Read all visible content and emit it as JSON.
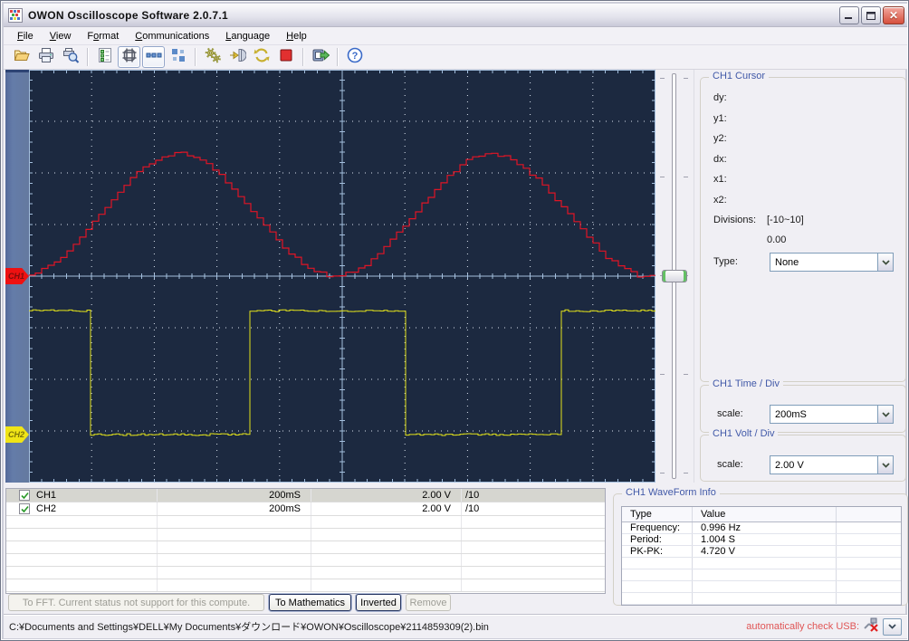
{
  "window": {
    "title": "OWON Oscilloscope Software 2.0.7.1"
  },
  "colors": {
    "scope_bg": "#1c2940",
    "grid_line": "#a3bedd",
    "grid_dot": "#dbe4f0",
    "left_strip": "#5f78a8",
    "group_title": "#4159a8",
    "usb_text": "#e05555"
  },
  "menu_bar": {
    "items": [
      {
        "label": "File",
        "underline": 0
      },
      {
        "label": "View",
        "underline": 0
      },
      {
        "label": "Format",
        "underline": 1
      },
      {
        "label": "Communications",
        "underline": 0
      },
      {
        "label": "Language",
        "underline": 0
      },
      {
        "label": "Help",
        "underline": 0
      }
    ]
  },
  "toolbar": {
    "items": [
      {
        "type": "button",
        "name": "open-file-button",
        "icon": "folder-open-icon"
      },
      {
        "type": "button",
        "name": "print-button",
        "icon": "printer-icon"
      },
      {
        "type": "button",
        "name": "print-preview-button",
        "icon": "print-preview-icon"
      },
      {
        "type": "separator"
      },
      {
        "type": "button",
        "name": "channel-list-button",
        "icon": "list-icon"
      },
      {
        "type": "button",
        "name": "grid-display-button",
        "icon": "grid-icon",
        "pressed": true
      },
      {
        "type": "button",
        "name": "dot-line-display-button",
        "icon": "dot-line-icon",
        "pressed": true
      },
      {
        "type": "button",
        "name": "tile-windows-button",
        "icon": "tile-icon"
      },
      {
        "type": "separator"
      },
      {
        "type": "button",
        "name": "settings-button",
        "icon": "gears-icon"
      },
      {
        "type": "button",
        "name": "connect-device-button",
        "icon": "connect-icon"
      },
      {
        "type": "button",
        "name": "refresh-button",
        "icon": "refresh-icon"
      },
      {
        "type": "button",
        "name": "stop-button",
        "icon": "stop-icon"
      },
      {
        "type": "separator"
      },
      {
        "type": "button",
        "name": "record-button",
        "icon": "record-icon"
      },
      {
        "type": "separator"
      },
      {
        "type": "button",
        "name": "help-button",
        "icon": "help-icon"
      }
    ]
  },
  "scope": {
    "channel_tags": [
      {
        "label": "CH1",
        "bg": "#ee1111",
        "text_color": "#7d0c0c",
        "zero_level_div": 0
      },
      {
        "label": "CH2",
        "bg": "#f0e416",
        "text_color": "#7c7308",
        "zero_level_div": -3.07
      }
    ]
  },
  "chart_data": {
    "type": "line",
    "title": "Oscilloscope waveform display",
    "x_divisions": 10,
    "y_divisions": 8,
    "time_per_div": "200mS",
    "series": [
      {
        "name": "CH1",
        "color": "#e01525",
        "shape": "stepped-sine",
        "volts_per_div": "2.00 V",
        "frequency_hz": 0.996,
        "period_s": 1.004,
        "peak_to_peak_v": 4.72,
        "midline_div": 1.18,
        "amplitude_div": 1.18,
        "period_div": 5.0,
        "first_peak_at_div": 2.35
      },
      {
        "name": "CH2",
        "color": "#e3e31a",
        "shape": "square",
        "volts_per_div": "2.00 V",
        "high_level_div": -0.67,
        "low_level_div": -3.07,
        "first_fall_at_div": 0.98,
        "half_period_div": 2.49
      }
    ]
  },
  "cursor_panel": {
    "title": "CH1 Cursor",
    "fields": [
      "dy:",
      "y1:",
      "y2:",
      "dx:",
      "x1:",
      "x2:"
    ],
    "divisions_label": "Divisions:",
    "divisions_range": "[-10~10]",
    "divisions_value": "0.00",
    "type_label": "Type:",
    "type_value": "None"
  },
  "time_panel": {
    "title": "CH1 Time / Div",
    "scale_label": "scale:",
    "value": "200mS"
  },
  "volt_panel": {
    "title": "CH1 Volt / Div",
    "scale_label": "scale:",
    "value": "2.00 V"
  },
  "channel_table": {
    "rows": [
      {
        "checked": true,
        "name": "CH1",
        "time_per_div": "200mS",
        "volts_per_div": "2.00 V",
        "probe": "/10",
        "selected": true
      },
      {
        "checked": true,
        "name": "CH2",
        "time_per_div": "200mS",
        "volts_per_div": "2.00 V",
        "probe": "/10",
        "selected": false
      }
    ],
    "empty_rows": 6
  },
  "compute_buttons": [
    {
      "name": "to-fft-button",
      "label": "To FFT. Current status not support for this compute.",
      "enabled": false
    },
    {
      "name": "to-mathematics-button",
      "label": "To Mathematics",
      "enabled": true
    },
    {
      "name": "inverted-button",
      "label": "Inverted",
      "enabled": true
    },
    {
      "name": "remove-button",
      "label": "Remove",
      "enabled": false
    }
  ],
  "waveform_info": {
    "title": "CH1 WaveForm Info",
    "columns": [
      "Type",
      "Value"
    ],
    "rows": [
      [
        "Frequency:",
        "0.996 Hz"
      ],
      [
        "Period:",
        "1.004 S"
      ],
      [
        "PK-PK:",
        "4.720 V"
      ]
    ],
    "empty_rows": 4
  },
  "status_bar": {
    "file_path": "C:¥Documents and Settings¥DELL¥My Documents¥ダウンロード¥OWON¥Oscilloscope¥2114859309(2).bin",
    "usb_label": "automatically check USB:"
  }
}
